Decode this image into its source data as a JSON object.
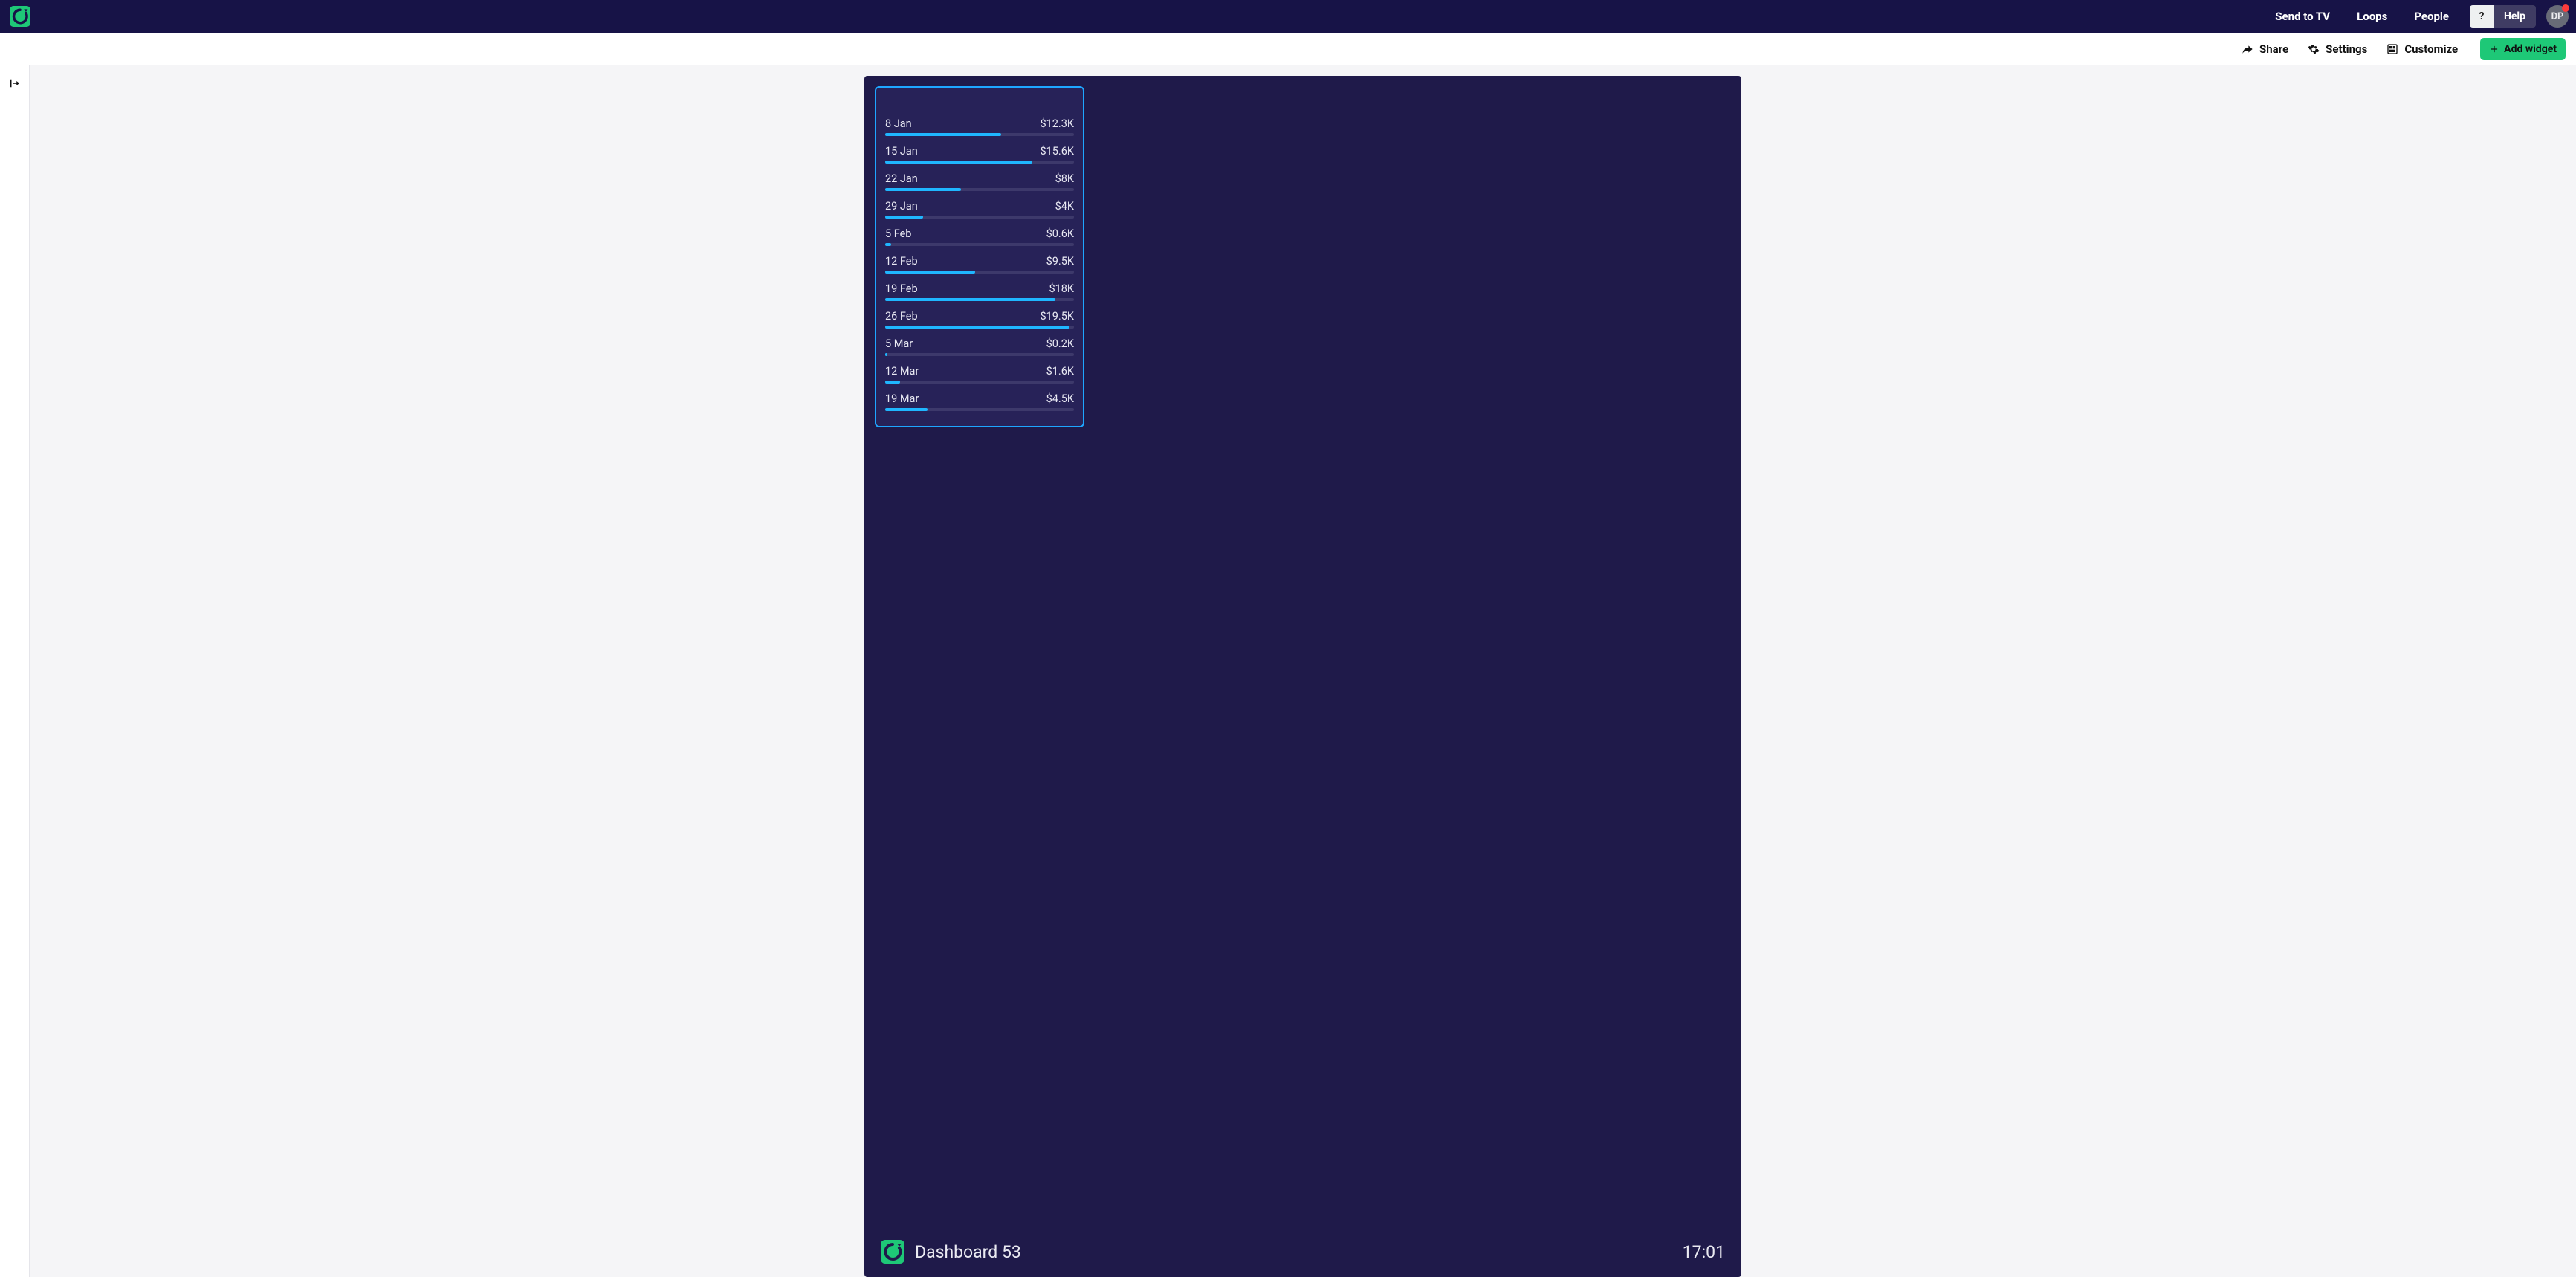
{
  "topbar": {
    "nav": {
      "send_to_tv": "Send to TV",
      "loops": "Loops",
      "people": "People"
    },
    "help_q": "?",
    "help_label": "Help",
    "avatar_initials": "DP"
  },
  "subbar": {
    "share": "Share",
    "settings": "Settings",
    "customize": "Customize",
    "add_widget": "Add widget"
  },
  "dashboard": {
    "title": "Dashboard 53",
    "clock": "17:01"
  },
  "chart_data": {
    "type": "bar",
    "title": "",
    "categories": [
      "8 Jan",
      "15 Jan",
      "22 Jan",
      "29 Jan",
      "5 Feb",
      "12 Feb",
      "19 Feb",
      "26 Feb",
      "5 Mar",
      "12 Mar",
      "19 Mar"
    ],
    "values": [
      12.3,
      15.6,
      8,
      4,
      0.6,
      9.5,
      18,
      19.5,
      0.2,
      1.6,
      4.5
    ],
    "value_labels": [
      "$12.3K",
      "$15.6K",
      "$8K",
      "$4K",
      "$0.6K",
      "$9.5K",
      "$18K",
      "$19.5K",
      "$0.2K",
      "$1.6K",
      "$4.5K"
    ],
    "unit": "K USD",
    "max_ref": 20
  }
}
